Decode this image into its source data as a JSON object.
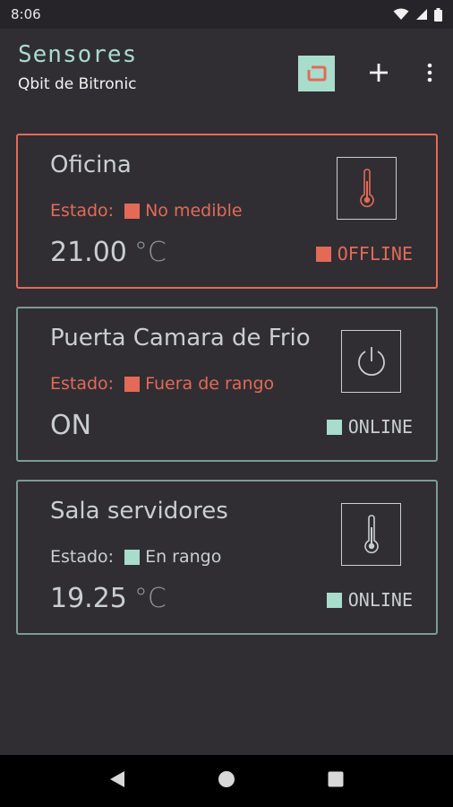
{
  "status_bar": {
    "time": "8:06",
    "icons": [
      "wifi-icon",
      "signal-icon",
      "battery-icon"
    ]
  },
  "app_bar": {
    "title": "Sensores",
    "subtitle": "Qbit de Bitronic",
    "actions": [
      "logo-icon",
      "add-icon",
      "more-vert-icon"
    ]
  },
  "colors": {
    "accent": "#a8dccb",
    "alert": "#e36a57",
    "ok": "#a8dccb",
    "border_normal": "#7a9b98",
    "background": "#302e33"
  },
  "sensors": [
    {
      "name": "Oficina",
      "estado_label": "Estado:",
      "estado": "No medible",
      "value": "21.00",
      "unit": "°C",
      "connection": "OFFLINE",
      "icon": "thermometer-icon"
    },
    {
      "name": "Puerta Camara de Frio",
      "estado_label": "Estado:",
      "estado": "Fuera de rango",
      "value": "ON",
      "unit": "",
      "connection": "ONLINE",
      "icon": "power-icon"
    },
    {
      "name": "Sala servidores",
      "estado_label": "Estado:",
      "estado": "En rango",
      "value": "19.25",
      "unit": "°C",
      "connection": "ONLINE",
      "icon": "thermometer-icon"
    }
  ],
  "nav_bar": {
    "buttons": [
      "back-icon",
      "home-icon",
      "recents-icon"
    ]
  }
}
